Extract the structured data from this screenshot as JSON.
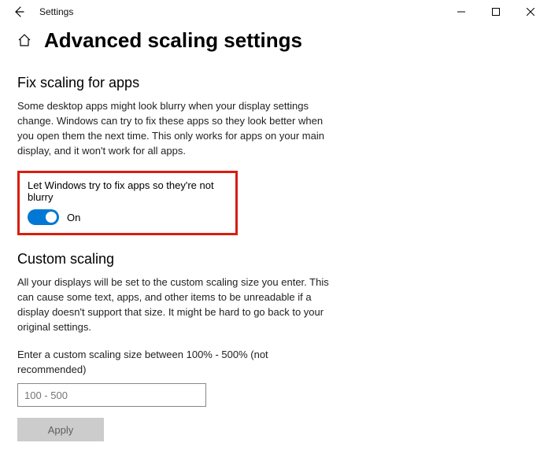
{
  "window": {
    "title": "Settings"
  },
  "page": {
    "heading": "Advanced scaling settings"
  },
  "fix_scaling": {
    "heading": "Fix scaling for apps",
    "description": "Some desktop apps might look blurry when your display settings change. Windows can try to fix these apps so they look better when you open them the next time. This only works for apps on your main display, and it won't work for all apps.",
    "toggle_label": "Let Windows try to fix apps so they're not blurry",
    "toggle_state": "On"
  },
  "custom_scaling": {
    "heading": "Custom scaling",
    "description": "All your displays will be set to the custom scaling size you enter. This can cause some text, apps, and other items to be unreadable if a display doesn't support that size. It might be hard to go back to your original settings.",
    "input_label": "Enter a custom scaling size between 100% - 500% (not recommended)",
    "input_placeholder": "100 - 500",
    "apply_label": "Apply"
  }
}
